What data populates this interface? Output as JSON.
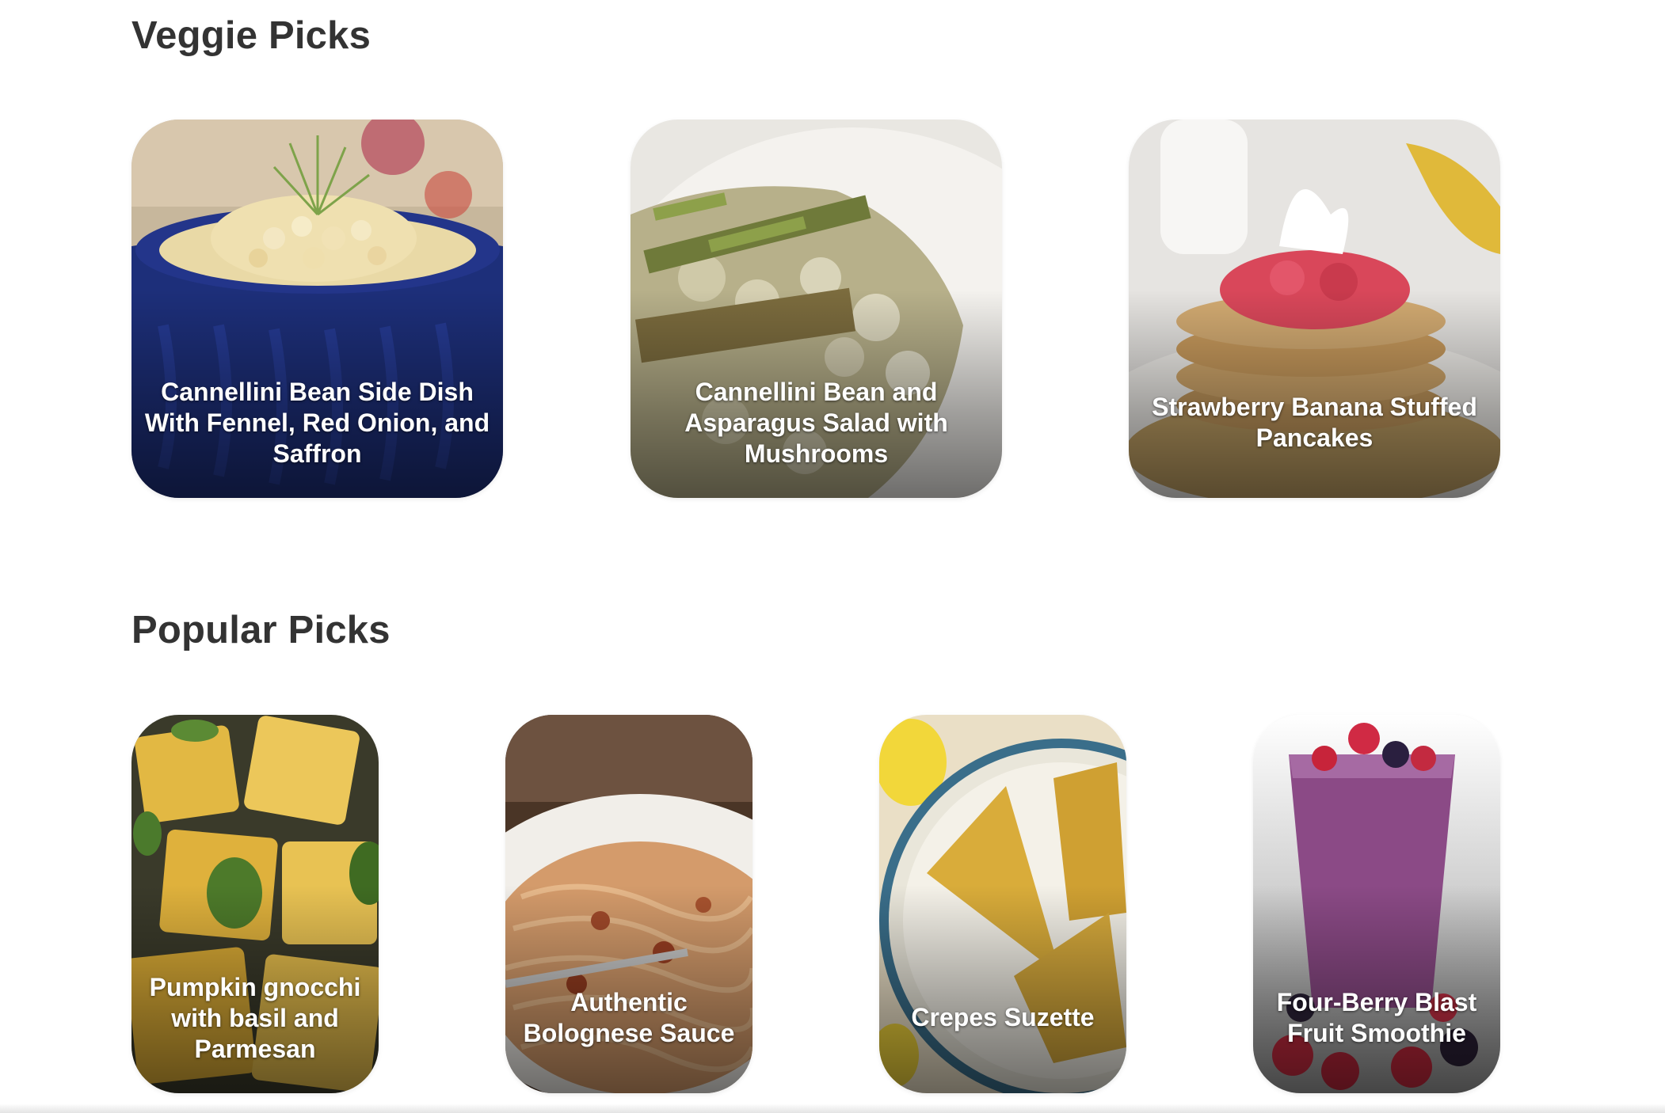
{
  "sections": {
    "veggie": {
      "title": "Veggie Picks",
      "items": [
        {
          "label": "Cannellini Bean Side Dish With Fennel, Red Onion, and Saffron"
        },
        {
          "label": "Cannellini Bean and Asparagus Salad with Mushrooms"
        },
        {
          "label": "Strawberry Banana Stuffed Pancakes"
        }
      ]
    },
    "popular": {
      "title": "Popular Picks",
      "items": [
        {
          "label": "Pumpkin gnocchi with basil and Parmesan"
        },
        {
          "label": "Authentic Bolognese Sauce"
        },
        {
          "label": "Crepes Suzette"
        },
        {
          "label": "Four-Berry Blast Fruit Smoothie"
        }
      ]
    }
  },
  "colors": {
    "heading": "#333333",
    "card_label": "#ffffff",
    "background": "#ffffff"
  }
}
